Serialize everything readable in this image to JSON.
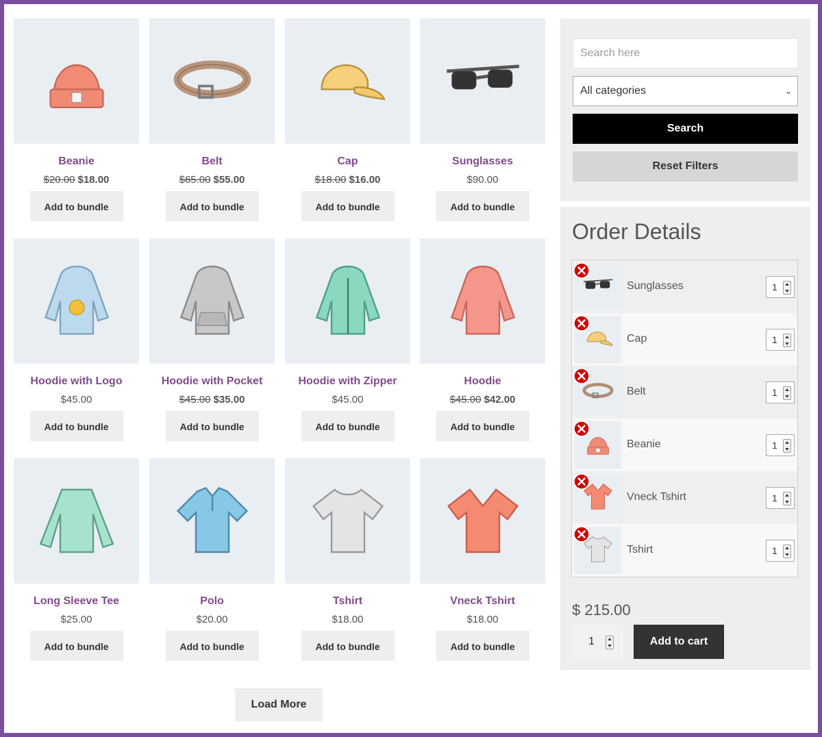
{
  "colors": {
    "frame": "#7c4f9e",
    "product_name": "#7f4b8a",
    "thumb_bg": "#e9eef3",
    "button_bg": "#eeeeee",
    "remove_icon": "#d40000"
  },
  "products": [
    {
      "name": "Beanie",
      "old_price": "$20.00",
      "price": "$18.00",
      "button": "Add to bundle",
      "icon": "beanie-icon"
    },
    {
      "name": "Belt",
      "old_price": "$65.00",
      "price": "$55.00",
      "button": "Add to bundle",
      "icon": "belt-icon"
    },
    {
      "name": "Cap",
      "old_price": "$18.00",
      "price": "$16.00",
      "button": "Add to bundle",
      "icon": "cap-icon"
    },
    {
      "name": "Sunglasses",
      "old_price": "",
      "price": "$90.00",
      "button": "Add to bundle",
      "icon": "sunglasses-icon"
    },
    {
      "name": "Hoodie with Logo",
      "old_price": "",
      "price": "$45.00",
      "button": "Add to bundle",
      "icon": "hoodie-logo-icon"
    },
    {
      "name": "Hoodie with Pocket",
      "old_price": "$45.00",
      "price": "$35.00",
      "button": "Add to bundle",
      "icon": "hoodie-pocket-icon"
    },
    {
      "name": "Hoodie with Zipper",
      "old_price": "",
      "price": "$45.00",
      "button": "Add to bundle",
      "icon": "hoodie-zipper-icon"
    },
    {
      "name": "Hoodie",
      "old_price": "$45.00",
      "price": "$42.00",
      "button": "Add to bundle",
      "icon": "hoodie-icon"
    },
    {
      "name": "Long Sleeve Tee",
      "old_price": "",
      "price": "$25.00",
      "button": "Add to bundle",
      "icon": "long-sleeve-icon"
    },
    {
      "name": "Polo",
      "old_price": "",
      "price": "$20.00",
      "button": "Add to bundle",
      "icon": "polo-icon"
    },
    {
      "name": "Tshirt",
      "old_price": "",
      "price": "$18.00",
      "button": "Add to bundle",
      "icon": "tshirt-icon"
    },
    {
      "name": "Vneck Tshirt",
      "old_price": "",
      "price": "$18.00",
      "button": "Add to bundle",
      "icon": "vneck-icon"
    }
  ],
  "load_more": "Load More",
  "filter": {
    "search_placeholder": "Search here",
    "category": "All categories",
    "search_button": "Search",
    "reset_button": "Reset Filters"
  },
  "order": {
    "title": "Order Details",
    "items": [
      {
        "name": "Sunglasses",
        "qty": "1",
        "icon": "sunglasses-icon"
      },
      {
        "name": "Cap",
        "qty": "1",
        "icon": "cap-icon"
      },
      {
        "name": "Belt",
        "qty": "1",
        "icon": "belt-icon"
      },
      {
        "name": "Beanie",
        "qty": "1",
        "icon": "beanie-icon"
      },
      {
        "name": "Vneck Tshirt",
        "qty": "1",
        "icon": "vneck-icon"
      },
      {
        "name": "Tshirt",
        "qty": "1",
        "icon": "tshirt-icon"
      }
    ],
    "total": "$ 215.00",
    "cart_qty": "1",
    "add_to_cart": "Add to cart"
  }
}
